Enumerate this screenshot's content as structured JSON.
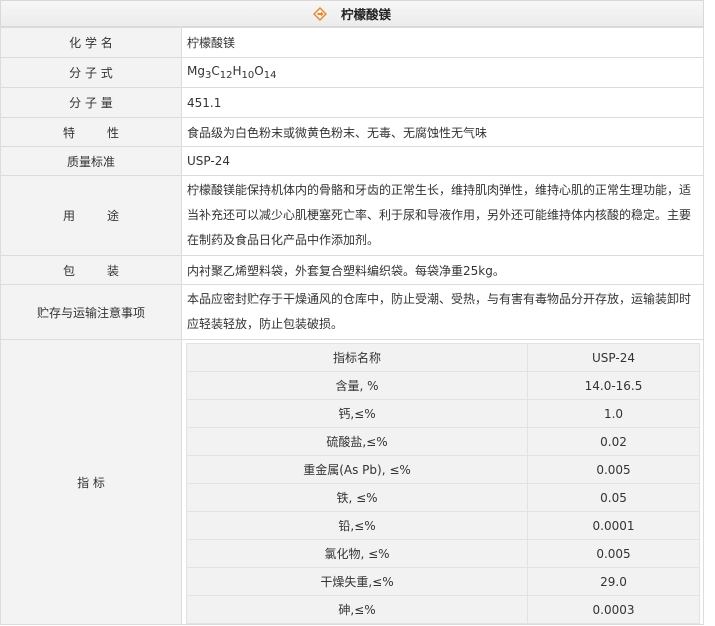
{
  "header": {
    "title": "柠檬酸镁"
  },
  "rows": {
    "chemical_name": {
      "label": "化 学 名",
      "value": "柠檬酸镁"
    },
    "formula": {
      "label": "分 子 式",
      "parts": [
        "Mg",
        "3",
        "C",
        "12",
        "H",
        "10",
        "O",
        "14"
      ]
    },
    "molecular_weight": {
      "label": "分 子 量",
      "value": "451.1"
    },
    "properties": {
      "label_a": "特",
      "label_b": "性",
      "value": "食品级为白色粉末或微黄色粉末、无毒、无腐蚀性无气味"
    },
    "standard": {
      "label": "质量标准",
      "value": "USP-24"
    },
    "usage": {
      "label_a": "用",
      "label_b": "途",
      "value": "柠檬酸镁能保持机体内的骨骼和牙齿的正常生长，维持肌肉弹性，维持心肌的正常生理功能，适当补充还可以减少心肌梗塞死亡率、利于尿和导液作用，另外还可能维持体内核酸的稳定。主要在制药及食品日化产品中作添加剂。"
    },
    "packaging": {
      "label_a": "包",
      "label_b": "装",
      "value": "内衬聚乙烯塑料袋，外套复合塑料编织袋。每袋净重25kg。"
    },
    "storage": {
      "label": "贮存与运输注意事项",
      "value": "本品应密封贮存于干燥通风的仓库中，防止受潮、受热，与有害有毒物品分开存放，运输装卸时应轻装轻放，防止包装破损。"
    },
    "specs": {
      "label": "指 标",
      "header": {
        "name": "指标名称",
        "value": "USP-24"
      },
      "items": [
        {
          "name": "含量, %",
          "value": "14.0-16.5"
        },
        {
          "name": "钙,≤%",
          "value": "1.0"
        },
        {
          "name": "硫酸盐,≤%",
          "value": "0.02"
        },
        {
          "name": "重金属(As Pb), ≤%",
          "value": "0.005"
        },
        {
          "name": "铁, ≤%",
          "value": "0.05"
        },
        {
          "name": "铅,≤%",
          "value": "0.0001"
        },
        {
          "name": "氯化物, ≤%",
          "value": "0.005"
        },
        {
          "name": "干燥失重,≤%",
          "value": "29.0"
        },
        {
          "name": "砷,≤%",
          "value": "0.0003"
        }
      ]
    }
  },
  "colors": {
    "label_bg": "#f3f3f3",
    "border": "#dcdcdc",
    "icon_orange": "#e8872a"
  },
  "icons": {
    "title": "diamond-arrow-icon"
  }
}
